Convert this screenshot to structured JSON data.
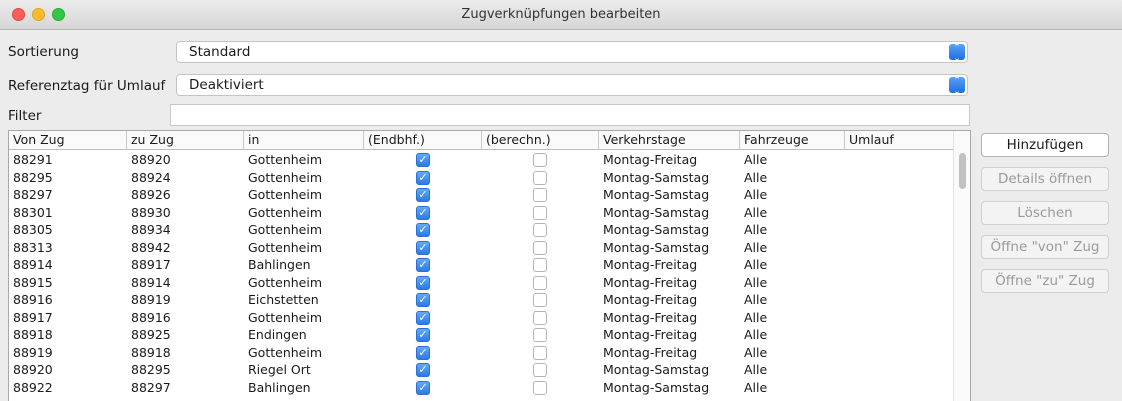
{
  "window": {
    "title": "Zugverknüpfungen bearbeiten"
  },
  "form": {
    "sort_label": "Sortierung",
    "sort_value": "Standard",
    "ref_label": "Referenztag für Umlauf",
    "ref_value": "Deaktiviert",
    "filter_label": "Filter",
    "filter_value": ""
  },
  "table": {
    "columns": [
      "Von Zug",
      "zu Zug",
      "in",
      "(Endbhf.)",
      "(berechn.)",
      "Verkehrstage",
      "Fahrzeuge",
      "Umlauf"
    ],
    "rows": [
      {
        "von": "88291",
        "zu": "88920",
        "in": "Gottenheim",
        "endbhf": true,
        "berechn": false,
        "tage": "Montag-Freitag",
        "fahrzeuge": "Alle",
        "umlauf": ""
      },
      {
        "von": "88295",
        "zu": "88924",
        "in": "Gottenheim",
        "endbhf": true,
        "berechn": false,
        "tage": "Montag-Samstag",
        "fahrzeuge": "Alle",
        "umlauf": ""
      },
      {
        "von": "88297",
        "zu": "88926",
        "in": "Gottenheim",
        "endbhf": true,
        "berechn": false,
        "tage": "Montag-Samstag",
        "fahrzeuge": "Alle",
        "umlauf": ""
      },
      {
        "von": "88301",
        "zu": "88930",
        "in": "Gottenheim",
        "endbhf": true,
        "berechn": false,
        "tage": "Montag-Samstag",
        "fahrzeuge": "Alle",
        "umlauf": ""
      },
      {
        "von": "88305",
        "zu": "88934",
        "in": "Gottenheim",
        "endbhf": true,
        "berechn": false,
        "tage": "Montag-Samstag",
        "fahrzeuge": "Alle",
        "umlauf": ""
      },
      {
        "von": "88313",
        "zu": "88942",
        "in": "Gottenheim",
        "endbhf": true,
        "berechn": false,
        "tage": "Montag-Samstag",
        "fahrzeuge": "Alle",
        "umlauf": ""
      },
      {
        "von": "88914",
        "zu": "88917",
        "in": "Bahlingen",
        "endbhf": true,
        "berechn": false,
        "tage": "Montag-Freitag",
        "fahrzeuge": "Alle",
        "umlauf": ""
      },
      {
        "von": "88915",
        "zu": "88914",
        "in": "Gottenheim",
        "endbhf": true,
        "berechn": false,
        "tage": "Montag-Freitag",
        "fahrzeuge": "Alle",
        "umlauf": ""
      },
      {
        "von": "88916",
        "zu": "88919",
        "in": "Eichstetten",
        "endbhf": true,
        "berechn": false,
        "tage": "Montag-Freitag",
        "fahrzeuge": "Alle",
        "umlauf": ""
      },
      {
        "von": "88917",
        "zu": "88916",
        "in": "Gottenheim",
        "endbhf": true,
        "berechn": false,
        "tage": "Montag-Freitag",
        "fahrzeuge": "Alle",
        "umlauf": ""
      },
      {
        "von": "88918",
        "zu": "88925",
        "in": "Endingen",
        "endbhf": true,
        "berechn": false,
        "tage": "Montag-Freitag",
        "fahrzeuge": "Alle",
        "umlauf": ""
      },
      {
        "von": "88919",
        "zu": "88918",
        "in": "Gottenheim",
        "endbhf": true,
        "berechn": false,
        "tage": "Montag-Freitag",
        "fahrzeuge": "Alle",
        "umlauf": ""
      },
      {
        "von": "88920",
        "zu": "88295",
        "in": "Riegel Ort",
        "endbhf": true,
        "berechn": false,
        "tage": "Montag-Samstag",
        "fahrzeuge": "Alle",
        "umlauf": ""
      },
      {
        "von": "88922",
        "zu": "88297",
        "in": "Bahlingen",
        "endbhf": true,
        "berechn": false,
        "tage": "Montag-Samstag",
        "fahrzeuge": "Alle",
        "umlauf": ""
      }
    ]
  },
  "buttons": {
    "add": "Hinzufügen",
    "details": "Details öffnen",
    "delete": "Löschen",
    "open_from": "Öffne \"von\" Zug",
    "open_to": "Öffne \"zu\" Zug"
  },
  "icons": {
    "combo_arrow": "updown-chevron-icon",
    "check": "checkmark-icon"
  },
  "colors": {
    "accent": "#2a7be6",
    "close": "#fc5f57",
    "minimize": "#fdbc2e",
    "maximize": "#33c748"
  }
}
